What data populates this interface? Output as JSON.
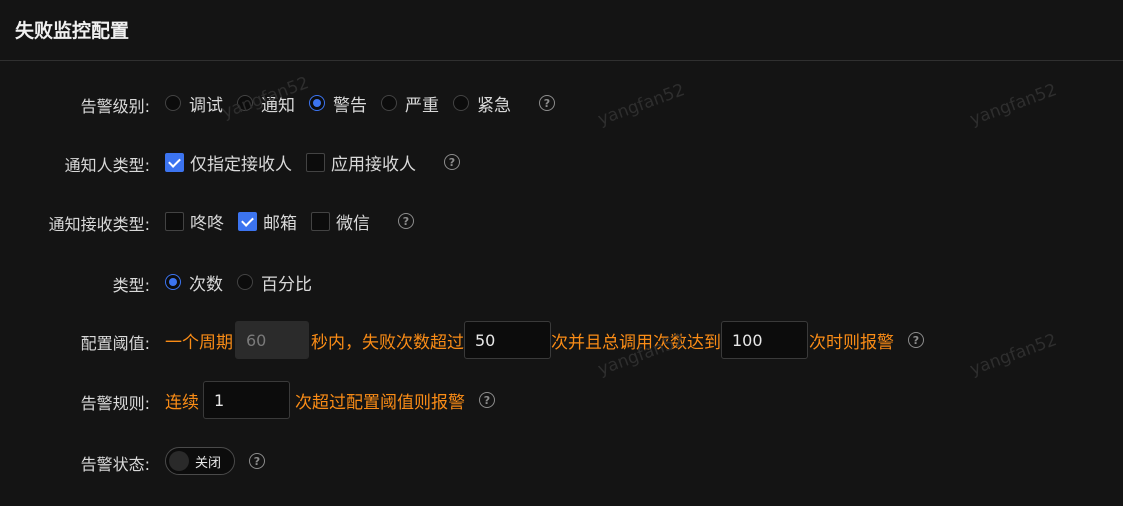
{
  "header": {
    "title": "失败监控配置"
  },
  "watermark": "yangfan52",
  "alert_level": {
    "label": "告警级别:",
    "options": [
      "调试",
      "通知",
      "警告",
      "严重",
      "紧急"
    ],
    "selected": "警告"
  },
  "notify_target": {
    "label": "通知人类型:",
    "options": [
      "仅指定接收人",
      "应用接收人"
    ],
    "checked": [
      "仅指定接收人"
    ]
  },
  "notify_channel": {
    "label": "通知接收类型:",
    "options": [
      "咚咚",
      "邮箱",
      "微信"
    ],
    "checked": [
      "邮箱"
    ]
  },
  "type": {
    "label": "类型:",
    "options": [
      "次数",
      "百分比"
    ],
    "selected": "次数"
  },
  "threshold": {
    "label": "配置阈值:",
    "text1": "一个周期",
    "period": "60",
    "text2": "秒内，失败次数超过",
    "fail_count": "50",
    "text3": "次并且总调用次数达到",
    "total_count": "100",
    "text4": "次时则报警"
  },
  "rule": {
    "label": "告警规则:",
    "text1": "连续",
    "count": "1",
    "text2": "次超过配置阈值则报警"
  },
  "status": {
    "label": "告警状态:",
    "switch_text": "关闭"
  },
  "colors": {
    "accent": "#3c74f0",
    "orange": "#fa8c16",
    "background": "#141414"
  }
}
